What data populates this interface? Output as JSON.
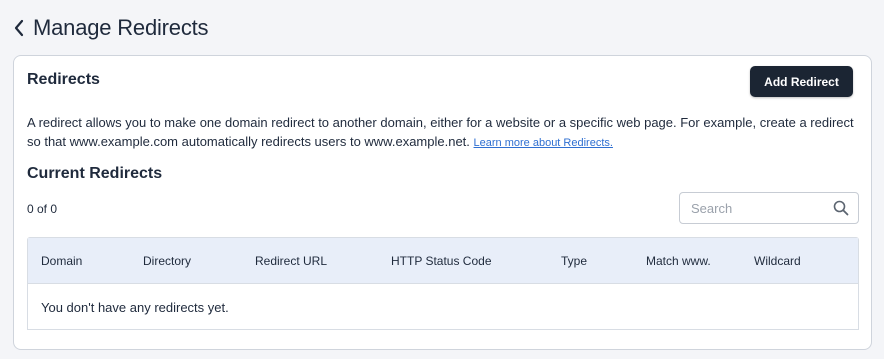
{
  "header": {
    "back_icon": "chevron-left-icon",
    "title": "Manage Redirects"
  },
  "card": {
    "title": "Redirects",
    "add_button_label": "Add Redirect",
    "description": "A redirect allows you to make one domain redirect to another domain, either for a website or a specific web page. For example, create a redirect so that www.example.com automatically redirects users to www.example.net.",
    "learn_more_link": "Learn more about Redirects."
  },
  "current": {
    "title": "Current Redirects",
    "count": "0 of 0",
    "search": {
      "placeholder": "Search",
      "value": "",
      "icon": "search-icon"
    }
  },
  "table": {
    "columns": [
      "Domain",
      "Directory",
      "Redirect URL",
      "HTTP Status Code",
      "Type",
      "Match www.",
      "Wildcard"
    ],
    "rows": [],
    "empty_message": "You don't have any redirects yet."
  },
  "colors": {
    "background": "#f4f5f8",
    "primary_button": "#1b2533",
    "link": "#2f6fd1",
    "table_header": "#e8eef9"
  }
}
